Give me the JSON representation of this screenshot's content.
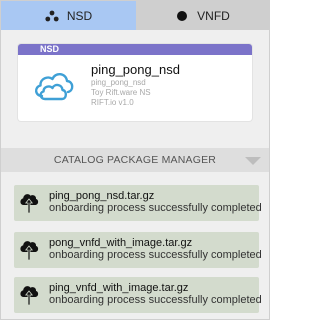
{
  "tabs": [
    {
      "label": "NSD",
      "icon": "network-nodes-icon",
      "active": true
    },
    {
      "label": "VNFD",
      "icon": "filled-circle-icon",
      "active": false
    }
  ],
  "nsd_card": {
    "band_label": "NSD",
    "title": "ping_pong_nsd",
    "lines": [
      "ping_pong_nsd",
      "Toy Rift.ware NS",
      "RIFT.io v1.0"
    ],
    "logo": "cloud-icon"
  },
  "catalog_header": {
    "label": "CATALOG PACKAGE MANAGER",
    "toggle_icon": "triangle-down-icon"
  },
  "packages": [
    {
      "name": "ping_pong_nsd.tar.gz",
      "status": "onboarding process successfully completed",
      "icon": "upload-cloud-icon"
    },
    {
      "name": "pong_vnfd_with_image.tar.gz",
      "status": "onboarding process successfully completed",
      "icon": "upload-cloud-icon"
    },
    {
      "name": "ping_vnfd_with_image.tar.gz",
      "status": "onboarding process successfully completed",
      "icon": "upload-cloud-icon"
    }
  ],
  "colors": {
    "active_tab": "#a9c8f3",
    "inactive_tab": "#cfcfcf",
    "nsd_band": "#7b73c9",
    "package_bg": "#d3dbcd",
    "cloud_logo": "#3fa0d6"
  }
}
